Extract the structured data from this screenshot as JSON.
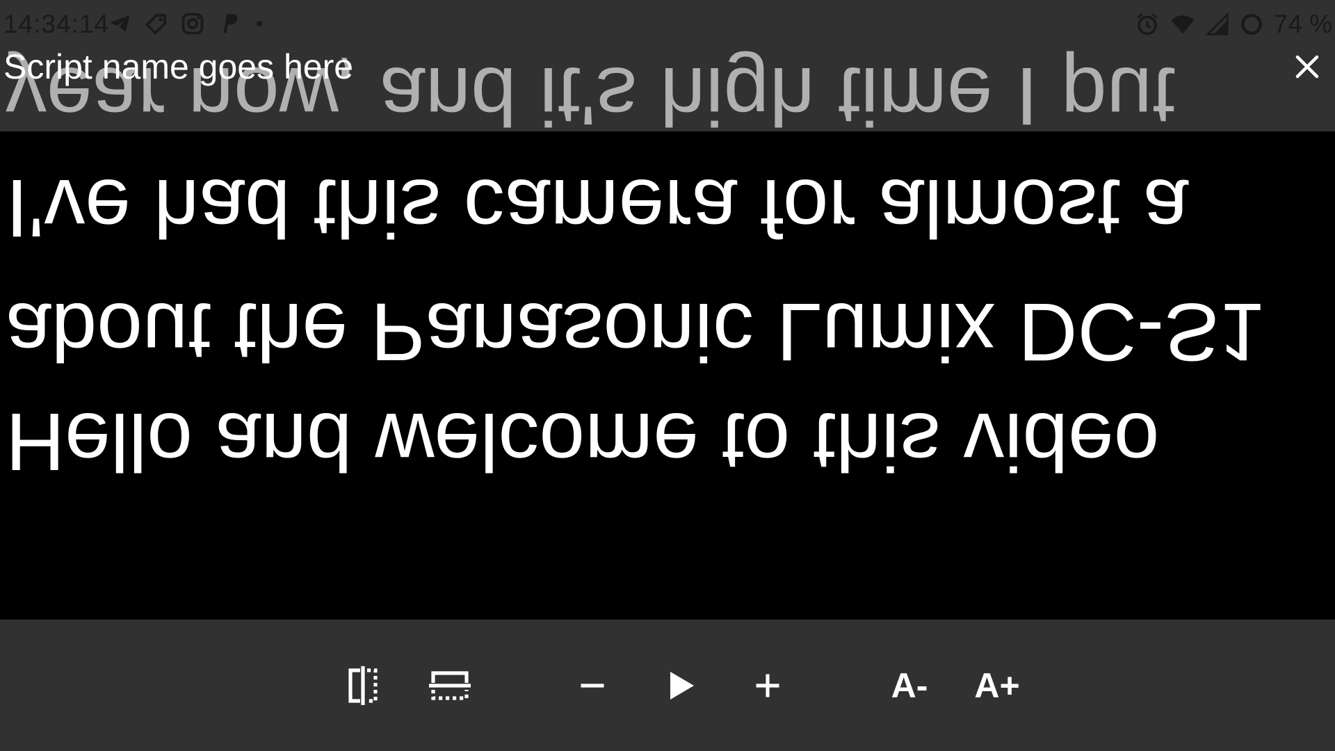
{
  "status_bar": {
    "time": "14:34:14",
    "left_icons": [
      "telegram-icon",
      "tag-icon",
      "instagram-icon",
      "paypal-icon",
      "dot-icon"
    ],
    "right_icons": [
      "alarm-icon",
      "wifi-icon",
      "cell-signal-icon",
      "battery-ring-icon"
    ],
    "battery": "74 %"
  },
  "header": {
    "script_title": "Script name goes here",
    "close_icon": "close-icon"
  },
  "script": {
    "mirrored": true,
    "lines": [
      "Hello and welcome to this video",
      "about the Panasonic Lumix DC-S1",
      "I've had this camera for almost a",
      "year now, and it's high time I put"
    ]
  },
  "toolbar": {
    "buttons": [
      {
        "name": "mirror-horizontal-button",
        "icon": "flip-horizontal-icon"
      },
      {
        "name": "mirror-vertical-button",
        "icon": "flip-vertical-icon"
      },
      {
        "name": "speed-down-button",
        "icon": "minus-icon"
      },
      {
        "name": "play-button",
        "icon": "play-icon"
      },
      {
        "name": "speed-up-button",
        "icon": "plus-icon"
      }
    ],
    "font_down_label": "A-",
    "font_up_label": "A+"
  },
  "colors": {
    "bar_background": "#313131",
    "script_background": "#000000",
    "script_text": "#ffffff",
    "script_text_dim": "#b0b0b0"
  }
}
